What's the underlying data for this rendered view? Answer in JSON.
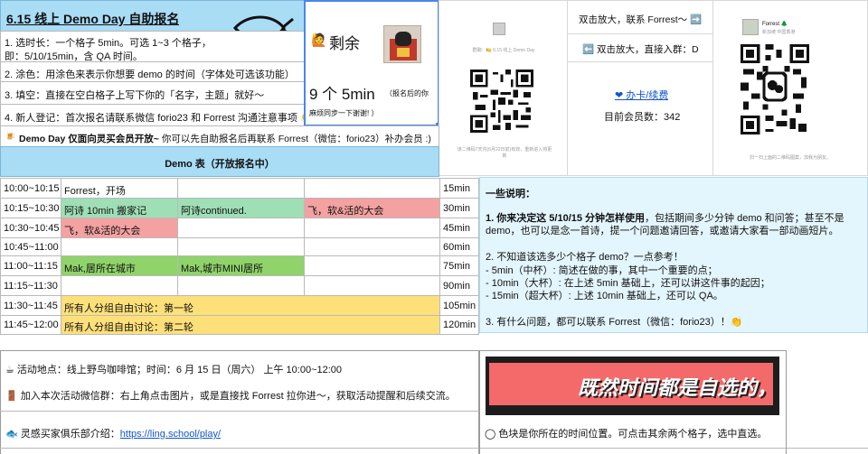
{
  "header": {
    "title": "6.15 线上 Demo Day 自助报名"
  },
  "rules": [
    "1. 选时长：一个格子 5min。可选 1~3 个格子，",
    "即：5/10/15min，含 QA 时间。",
    "2. 涂色：用涂色来表示你想要 demo 的时间（字体处可选该功能）",
    "3. 填空：直接在空白格子上写下你的「名字，主题」就好～",
    "4. 新人登记：首次报名请联系微信 forio23 和 Forrest 沟通注意事项 👏"
  ],
  "notice": {
    "icon": "🍺",
    "bold": "Demo Day 仅面向灵买会员开放~",
    "rest": " 你可以先自助报名后再联系 Forrest（微信：forio23）补办会员 :)"
  },
  "remaining": {
    "icon": "🙋",
    "label": "剩余",
    "count_line": "9  个 5min",
    "count_note": "（报名后的你",
    "note2": "麻烦同步一下谢谢! ）"
  },
  "group_qr": {
    "caption": "群聊：🍋 6.15 线上 Demo Day",
    "footer": "该二维码7天内(6月22日前)有效，重新进入将更新"
  },
  "membership": {
    "zoom_contact": "双击放大，联系 Forrest～ ➡️",
    "zoom_group": "⬅️  双击放大，直接入群：D",
    "card_link": "❤ 办卡/续费",
    "member_count": "目前会员数：342"
  },
  "personal_qr": {
    "name": "Forrest 🌲",
    "sub": "新加坡  中国香港",
    "footer": "扫一扫上面的二维码图案，加我为朋友。"
  },
  "schedule": {
    "header": "Demo 表（开放报名中）",
    "rows": [
      {
        "time": "10:00~10:15",
        "c1": "Forrest，开场",
        "c2": "",
        "c3": "",
        "dur": "15min"
      },
      {
        "time": "10:15~10:30",
        "c1": "阿诗 10min 搬家记",
        "c2": "阿诗continued.",
        "c3": "飞，软&活的大会",
        "dur": "30min"
      },
      {
        "time": "10:30~10:45",
        "c1": "飞，软&活的大会",
        "c2": "",
        "c3": "",
        "dur": "45min"
      },
      {
        "time": "10:45~11:00",
        "c1": "",
        "c2": "",
        "c3": "",
        "dur": "60min"
      },
      {
        "time": "11:00~11:15",
        "c1": "Mak,居所在城市",
        "c2": "Mak,城市MINI居所",
        "c3": "",
        "dur": "75min"
      },
      {
        "time": "11:15~11:30",
        "c1": "",
        "c2": "",
        "c3": "",
        "dur": "90min"
      },
      {
        "time": "11:30~11:45",
        "c1": "所有人分组自由讨论：第一轮",
        "c2": "",
        "c3": "",
        "dur": "105min"
      },
      {
        "time": "11:45~12:00",
        "c1": "所有人分组自由讨论：第二轮",
        "c2": "",
        "c3": "",
        "dur": "120min"
      }
    ]
  },
  "notes": {
    "heading": "一些说明：",
    "p1_bold": "1. 你来决定这 5/10/15 分钟怎样使用",
    "p1_rest": "，包括期间多少分钟 demo 和问答；甚至不是",
    "p1_line2": "demo，也可以是念一首诗，提一个问题邀请回答，或邀请大家看一部动画短片。",
    "p2": "2. 不知道该选多少个格子 demo？一点参考！",
    "p2_a": "- 5min（中杯）: 简述在做的事，其中一个重要的点；",
    "p2_b": "- 10min（大杯）: 在上述 5min 基础上，还可以讲这件事的起因；",
    "p2_c": "- 15min（超大杯）: 上述 10min 基础上，还可以 QA。",
    "p3": "3. 有什么问题，都可以联系 Forrest（微信：forio23）！👏"
  },
  "footer": {
    "location": "☕  活动地点：线上野鸟咖啡馆；时间：6 月 15 日（周六） 上午 10:00~12:00",
    "join": "🚪  加入本次活动微信群：右上角点击图片，或是直接找 Forrest 拉你进～，获取活动提醒和后续交流。",
    "club_label": "🐟  灵感买家俱乐部介绍：",
    "club_link": "https://ling.school/play/",
    "banner": "既然时间都是自选的，",
    "color_tip": "◯  色块是你所在的时间位置。可点击其余两个格子，选中直选。"
  },
  "colors": {
    "title_bg": "#a9dcf5",
    "notes_bg": "#e3f5fd",
    "green": "#9fdfb6",
    "red": "#f4a1a1",
    "lime": "#8fd36a",
    "yellow": "#fde07a",
    "banner_bg": "#f46a6a",
    "link": "#1155cc"
  }
}
